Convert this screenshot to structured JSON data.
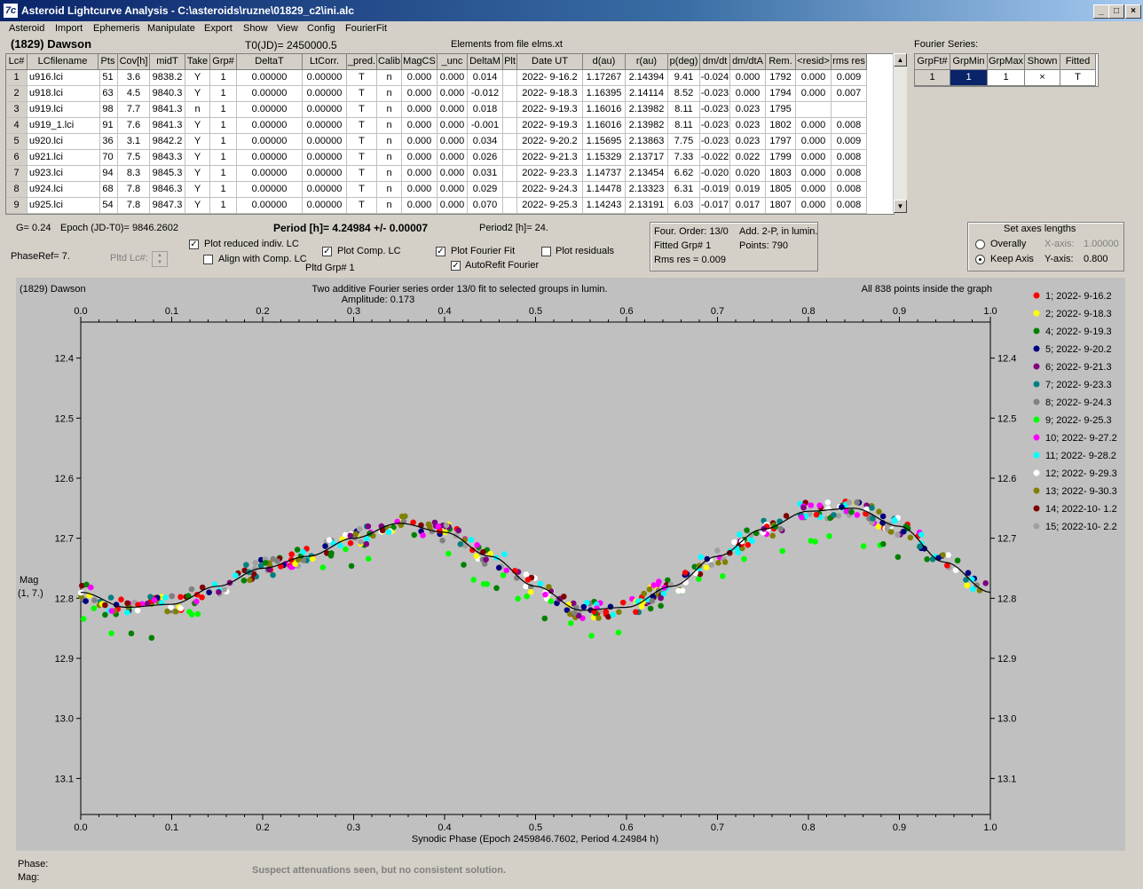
{
  "window": {
    "title": "Asteroid Lightcurve Analysis - C:\\asteroids\\ruzne\\01829_c2\\ini.alc",
    "icon": "7c",
    "min_label": "_",
    "max_label": "□",
    "close_label": "×"
  },
  "menu": [
    "Asteroid",
    "Import",
    "Ephemeris",
    "Manipulate",
    "Export",
    "Show",
    "View",
    "Config",
    "FourierFit"
  ],
  "header": {
    "asteroid": "(1829) Dawson",
    "t0": "T0(JD)= 2450000.5",
    "elements": "Elements from file elms.xt",
    "fourier_label": "Fourier Series:"
  },
  "table": {
    "columns": [
      "Lc#",
      "LCfilename",
      "Pts",
      "Cov[h]",
      "midT",
      "Take",
      "Grp#",
      "DeltaT",
      "LtCorr.",
      "_pred.",
      "Calib",
      "MagCS",
      "_unc",
      "DeltaM",
      "Plt",
      "Date UT",
      "d(au)",
      "r(au)",
      "p(deg)",
      "dm/dt",
      "dm/dtA",
      "Rem.",
      "<resid>",
      "rms res"
    ],
    "rows": [
      [
        "1",
        "u916.lci",
        "51",
        "3.6",
        "9838.2",
        "Y",
        "1",
        "0.00000",
        "0.00000",
        "T",
        "n",
        "0.000",
        "0.000",
        "0.014",
        "",
        "2022- 9-16.2",
        "1.17267",
        "2.14394",
        "9.41",
        "-0.024",
        "0.000",
        "1792",
        "0.000",
        "0.009"
      ],
      [
        "2",
        "u918.lci",
        "63",
        "4.5",
        "9840.3",
        "Y",
        "1",
        "0.00000",
        "0.00000",
        "T",
        "n",
        "0.000",
        "0.000",
        "-0.012",
        "",
        "2022- 9-18.3",
        "1.16395",
        "2.14114",
        "8.52",
        "-0.023",
        "0.000",
        "1794",
        "0.000",
        "0.007"
      ],
      [
        "3",
        "u919.lci",
        "98",
        "7.7",
        "9841.3",
        "n",
        "1",
        "0.00000",
        "0.00000",
        "T",
        "n",
        "0.000",
        "0.000",
        "0.018",
        "",
        "2022- 9-19.3",
        "1.16016",
        "2.13982",
        "8.11",
        "-0.023",
        "0.023",
        "1795",
        "",
        ""
      ],
      [
        "4",
        "u919_1.lci",
        "91",
        "7.6",
        "9841.3",
        "Y",
        "1",
        "0.00000",
        "0.00000",
        "T",
        "n",
        "0.000",
        "0.000",
        "-0.001",
        "",
        "2022- 9-19.3",
        "1.16016",
        "2.13982",
        "8.11",
        "-0.023",
        "0.023",
        "1802",
        "0.000",
        "0.008"
      ],
      [
        "5",
        "u920.lci",
        "36",
        "3.1",
        "9842.2",
        "Y",
        "1",
        "0.00000",
        "0.00000",
        "T",
        "n",
        "0.000",
        "0.000",
        "0.034",
        "",
        "2022- 9-20.2",
        "1.15695",
        "2.13863",
        "7.75",
        "-0.023",
        "0.023",
        "1797",
        "0.000",
        "0.009"
      ],
      [
        "6",
        "u921.lci",
        "70",
        "7.5",
        "9843.3",
        "Y",
        "1",
        "0.00000",
        "0.00000",
        "T",
        "n",
        "0.000",
        "0.000",
        "0.026",
        "",
        "2022- 9-21.3",
        "1.15329",
        "2.13717",
        "7.33",
        "-0.022",
        "0.022",
        "1799",
        "0.000",
        "0.008"
      ],
      [
        "7",
        "u923.lci",
        "94",
        "8.3",
        "9845.3",
        "Y",
        "1",
        "0.00000",
        "0.00000",
        "T",
        "n",
        "0.000",
        "0.000",
        "0.031",
        "",
        "2022- 9-23.3",
        "1.14737",
        "2.13454",
        "6.62",
        "-0.020",
        "0.020",
        "1803",
        "0.000",
        "0.008"
      ],
      [
        "8",
        "u924.lci",
        "68",
        "7.8",
        "9846.3",
        "Y",
        "1",
        "0.00000",
        "0.00000",
        "T",
        "n",
        "0.000",
        "0.000",
        "0.029",
        "",
        "2022- 9-24.3",
        "1.14478",
        "2.13323",
        "6.31",
        "-0.019",
        "0.019",
        "1805",
        "0.000",
        "0.008"
      ],
      [
        "9",
        "u925.lci",
        "54",
        "7.8",
        "9847.3",
        "Y",
        "1",
        "0.00000",
        "0.00000",
        "T",
        "n",
        "0.000",
        "0.000",
        "0.070",
        "",
        "2022- 9-25.3",
        "1.14243",
        "2.13191",
        "6.03",
        "-0.017",
        "0.017",
        "1807",
        "0.000",
        "0.008"
      ]
    ]
  },
  "fourier_table": {
    "columns": [
      "GrpFt#",
      "GrpMin",
      "GrpMax",
      "Shown",
      "Fitted"
    ],
    "row": [
      "1",
      "1",
      "1",
      "×",
      "T"
    ]
  },
  "info": {
    "g": "G= 0.24",
    "epoch": "Epoch (JD-T0)= 9846.2602",
    "period": "Period [h]= 4.24984 +/- 0.00007",
    "period2": "Period2 [h]= 24.",
    "phaseref": "PhaseRef= 7.",
    "pltd_lc": "Pltd Lc#:",
    "pltd_grp": "Pltd Grp#  1",
    "plot_reduced": "Plot reduced indiv. LC",
    "align_comp": "Align with Comp. LC",
    "plot_comp": "Plot Comp. LC",
    "plot_fourier": "Plot Fourier Fit",
    "autorefit": "AutoRefit Fourier",
    "plot_resid": "Plot residuals",
    "four_order": "Four. Order: 13/0",
    "add_2p": "Add. 2-P, in lumin.",
    "fitted_grp": "Fitted Grp# 1",
    "points": "Points: 790",
    "rms_res": "Rms res     = 0.009",
    "axes_title": "Set axes lengths",
    "overally": "Overally",
    "keep_axis": "Keep Axis",
    "xaxis_lbl": "X-axis:",
    "xaxis_val": "1.00000",
    "yaxis_lbl": "Y-axis:",
    "yaxis_val": "0.800"
  },
  "checks": {
    "plot_reduced": true,
    "align_comp": false,
    "plot_comp": true,
    "plot_fourier": true,
    "autorefit": true,
    "plot_resid": false
  },
  "chart_data": {
    "type": "scatter",
    "title": "Two additive Fourier series order 13/0 fit to selected groups in lumin.",
    "subtitle": "Amplitude: 0.173",
    "corner_left": "(1829) Dawson",
    "corner_right": "All 838 points inside the graph",
    "xlabel": "Synodic Phase (Epoch 2459846.7602, Period 4.24984 h)",
    "ylabel": "Mag",
    "ylabel2": "(1, 7.)",
    "xlim": [
      0.0,
      1.0
    ],
    "ylim": [
      12.34,
      13.16
    ],
    "y_inverted": true,
    "xticks": [
      "0.0",
      "0.1",
      "0.2",
      "0.3",
      "0.4",
      "0.5",
      "0.6",
      "0.7",
      "0.8",
      "0.9",
      "1.0"
    ],
    "yticks": [
      "12.4",
      "12.5",
      "12.6",
      "12.7",
      "12.8",
      "12.9",
      "13.0",
      "13.1"
    ],
    "fit_curve": {
      "x": [
        0.0,
        0.05,
        0.1,
        0.15,
        0.2,
        0.25,
        0.3,
        0.35,
        0.4,
        0.45,
        0.5,
        0.55,
        0.6,
        0.65,
        0.7,
        0.75,
        0.8,
        0.85,
        0.9,
        0.95,
        1.0
      ],
      "y": [
        12.79,
        12.815,
        12.81,
        12.78,
        12.75,
        12.73,
        12.7,
        12.675,
        12.69,
        12.73,
        12.78,
        12.82,
        12.815,
        12.78,
        12.73,
        12.685,
        12.655,
        12.65,
        12.68,
        12.74,
        12.79
      ]
    },
    "series": [
      {
        "name": "1; 2022- 9-16.2",
        "color": "#ff0000"
      },
      {
        "name": "2; 2022- 9-18.3",
        "color": "#ffff00"
      },
      {
        "name": "4; 2022- 9-19.3",
        "color": "#008000"
      },
      {
        "name": "5; 2022- 9-20.2",
        "color": "#000080"
      },
      {
        "name": "6; 2022- 9-21.3",
        "color": "#800080"
      },
      {
        "name": "7; 2022- 9-23.3",
        "color": "#008080"
      },
      {
        "name": "8; 2022- 9-24.3",
        "color": "#808080"
      },
      {
        "name": "9; 2022- 9-25.3",
        "color": "#00ff00"
      },
      {
        "name": "10; 2022- 9-27.2",
        "color": "#ff00ff"
      },
      {
        "name": "11; 2022- 9-28.2",
        "color": "#00ffff"
      },
      {
        "name": "12; 2022- 9-29.3",
        "color": "#ffffff"
      },
      {
        "name": "13; 2022- 9-30.3",
        "color": "#808000"
      },
      {
        "name": "14; 2022-10- 1.2",
        "color": "#800000"
      },
      {
        "name": "15; 2022-10- 2.2",
        "color": "#a0a0a0"
      }
    ]
  },
  "status": {
    "phase": "Phase:",
    "mag": "Mag:",
    "message": "Suspect attenuations seen, but no consistent solution."
  }
}
